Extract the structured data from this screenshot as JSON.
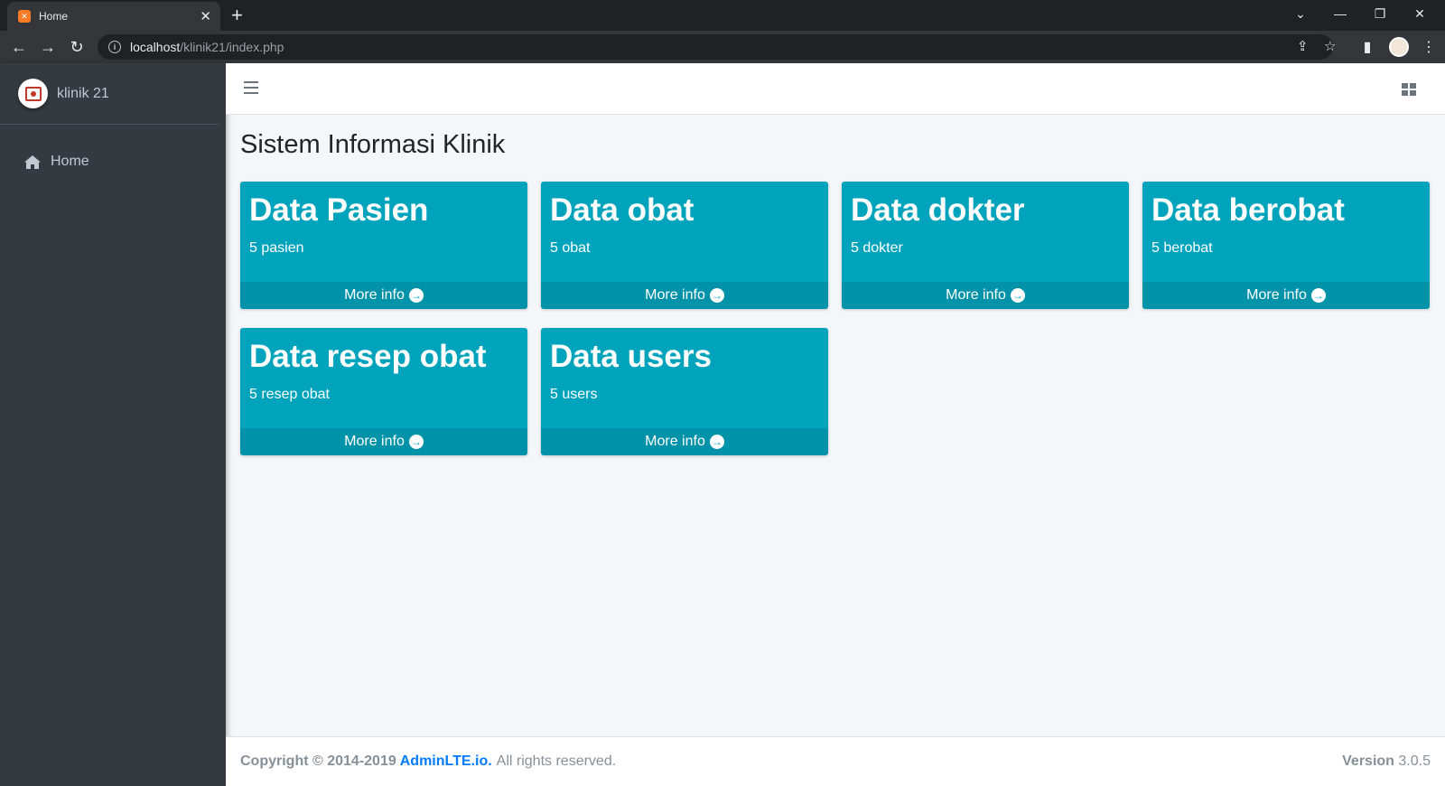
{
  "browser": {
    "tab_title": "Home",
    "tab_favicon": "xampp-icon",
    "url_host": "localhost",
    "url_path": "/klinik21/index.php"
  },
  "sidebar": {
    "brand": "klinik 21",
    "items": [
      {
        "label": "Home",
        "icon": "home-icon"
      }
    ]
  },
  "content": {
    "title": "Sistem Informasi Klinik",
    "boxes": [
      {
        "heading": "Data Pasien",
        "sub": "5 pasien",
        "link": "More info"
      },
      {
        "heading": "Data obat",
        "sub": "5 obat",
        "link": "More info"
      },
      {
        "heading": "Data dokter",
        "sub": "5 dokter",
        "link": "More info"
      },
      {
        "heading": "Data berobat",
        "sub": "5 berobat",
        "link": "More info"
      },
      {
        "heading": "Data resep obat",
        "sub": "5 resep obat",
        "link": "More info"
      },
      {
        "heading": "Data users",
        "sub": "5 users",
        "link": "More info"
      }
    ]
  },
  "footer": {
    "copyright": "Copyright © 2014-2019",
    "brand_link": "AdminLTE.io.",
    "rights": "All rights reserved.",
    "version_label": "Version",
    "version_number": "3.0.5"
  },
  "colors": {
    "accent": "#00a3bc",
    "sidebar_bg": "#343a40",
    "link": "#007bff"
  }
}
